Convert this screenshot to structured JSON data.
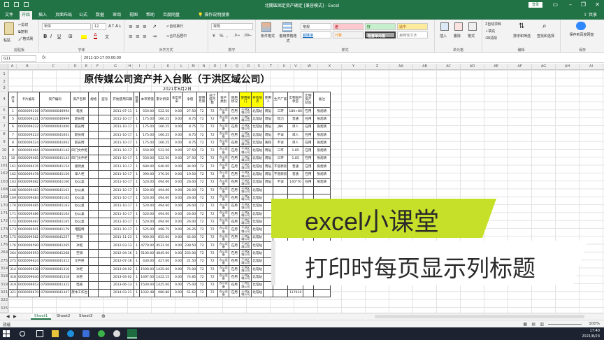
{
  "window": {
    "title": "北關區固定资产确定 [兼容模式] - Excel",
    "login_label": "登录"
  },
  "tabs": [
    "文件",
    "开始",
    "插入",
    "页面布局",
    "公式",
    "数据",
    "审阅",
    "视图",
    "帮助",
    "百度网盘",
    "操作说明搜索"
  ],
  "share_label": "共享",
  "ribbon": {
    "clipboard": {
      "group": "剪贴板",
      "paste": "粘贴",
      "cut": "剪切",
      "copy": "复制",
      "format_painter": "格式刷"
    },
    "font": {
      "group": "字体",
      "font_name": "宋体",
      "font_size": "12",
      "bold": "B",
      "italic": "I",
      "underline": "U",
      "font_color_icon": "A"
    },
    "alignment": {
      "group": "对齐方式",
      "wrap": "自动换行",
      "merge": "合并后居中"
    },
    "number": {
      "group": "数字",
      "format": "常规"
    },
    "styles": {
      "group": "样式",
      "conditional": "条件格式",
      "table_format": "套用表格格式",
      "cells": [
        {
          "label": "常规",
          "bg": "#ffffff",
          "fg": "#222222"
        },
        {
          "label": "差",
          "bg": "#ffc7ce",
          "fg": "#9c0006"
        },
        {
          "label": "好",
          "bg": "#c6efce",
          "fg": "#006100"
        },
        {
          "label": "适中",
          "bg": "#ffeb9c",
          "fg": "#9c5700"
        },
        {
          "label": "超链接",
          "bg": "#ffffff",
          "fg": "#0563c1"
        },
        {
          "label": "计算",
          "bg": "#f2f2f2",
          "fg": "#fa7d00"
        },
        {
          "label": "检查单元格",
          "bg": "#a5a5a5",
          "fg": "#ffffff"
        },
        {
          "label": "解释性文本",
          "bg": "#ffffff",
          "fg": "#7f7f7f"
        }
      ]
    },
    "cells_group": {
      "group": "单元格",
      "insert": "插入",
      "delete": "删除",
      "format": "格式"
    },
    "editing": {
      "group": "编辑",
      "autosum": "自动求和",
      "fill": "填充",
      "clear": "清除",
      "sort": "排序和筛选",
      "find": "查找和选择"
    },
    "save": {
      "group": "保存",
      "label": "保存到百度网盘"
    }
  },
  "formula_bar": {
    "name_box": "G11",
    "fx": "fx",
    "value": "2011-10-17 00:00:00"
  },
  "columns": [
    "A",
    "B",
    "C",
    "D",
    "E",
    "F",
    "G",
    "H",
    "I",
    "J",
    "K",
    "L",
    "M",
    "N",
    "O",
    "P",
    "Q",
    "R",
    "S",
    "T",
    "U",
    "V",
    "W",
    "X",
    "Y",
    "Z",
    "AA",
    "AB",
    "AC",
    "AD",
    "AE",
    "AF",
    "AG",
    "AH",
    "AI"
  ],
  "row_numbers": [
    "1",
    "2",
    "3",
    "4",
    "5",
    "6",
    "7",
    "8",
    "9",
    "10",
    "11",
    "161",
    "162",
    "163",
    "168",
    "169",
    "170",
    "171",
    "172",
    "173",
    "175",
    "176",
    "264",
    "275",
    "314",
    "318",
    "319",
    "321",
    "322",
    "325"
  ],
  "report": {
    "title": "原传媒公司资产并入台账（于洪区域公司）",
    "date": "2021年6月2日",
    "headers": [
      "序号",
      "卡片编号",
      "资产编码",
      "资产名称",
      "规格",
      "型号",
      "开始使用日期",
      "数量",
      "本币原值",
      "累计折旧",
      "本年折旧",
      "净值",
      "使用月限",
      "已计提月数",
      "资产类别",
      "使用状况",
      "使用部门",
      "存放地点",
      "使用人",
      "生产厂家",
      "实物资产状态",
      "实物资产状态",
      "备注"
    ],
    "highlight_headers": [
      16,
      17
    ],
    "rows": [
      [
        "1",
        "0000009216",
        "07000000040994",
        "电视",
        "",
        "",
        "2011-07-11",
        "1",
        "550.00",
        "522.50",
        "0.00",
        "27.50",
        "72",
        "72",
        "办公设备",
        "在用",
        "于洪区域公司",
        "北馆站",
        "周韬",
        "三环",
        "180+80",
        "在用",
        "张旭清"
      ],
      [
        "5",
        "0000009221",
        "07000000040999",
        "职员椅",
        "",
        "",
        "2011-10-17",
        "1",
        "175.00",
        "166.25",
        "0.00",
        "8.75",
        "72",
        "72",
        "办公设备",
        "在用",
        "于洪区域公司",
        "北馆站",
        "周韬",
        "得力",
        "普通",
        "在用",
        "张旭清"
      ],
      [
        "6",
        "0000009222",
        "07000000041000",
        "职员椅",
        "",
        "",
        "2011-10-17",
        "1",
        "175.00",
        "166.25",
        "0.00",
        "8.75",
        "72",
        "72",
        "办公设备",
        "在用",
        "于洪区域公司",
        "北馆站",
        "周韬",
        "JN6",
        "单人",
        "在用",
        "张旭清"
      ],
      [
        "7",
        "0000009223",
        "07000000041001",
        "职员椅",
        "",
        "",
        "2011-10-17",
        "1",
        "175.00",
        "166.25",
        "0.00",
        "8.75",
        "72",
        "72",
        "办公设备",
        "在用",
        "于洪区域公司",
        "北馆站",
        "周韬",
        "不详",
        "单人",
        "在用",
        "张旭清"
      ],
      [
        "8",
        "0000009224",
        "07000000041002",
        "职员椅",
        "",
        "",
        "2011-10-17",
        "1",
        "175.00",
        "166.25",
        "0.00",
        "8.75",
        "72",
        "72",
        "办公设备",
        "在用",
        "于洪区域公司",
        "北馆站",
        "黄辉",
        "不详",
        "单人",
        "在用",
        "张旭清"
      ],
      [
        "9",
        "0000009464",
        "07000000041142",
        "四门文件柜",
        "",
        "",
        "2011-10-17",
        "1",
        "550.00",
        "522.50",
        "0.00",
        "27.50",
        "72",
        "72",
        "办公设备",
        "在用",
        "于洪区域公司",
        "北馆站",
        "周韬",
        "三环",
        "1.85",
        "在用",
        "张旭清"
      ],
      [
        "10",
        "0000009465",
        "07000000041143",
        "四门文件柜",
        "",
        "",
        "2011-10-17",
        "1",
        "550.00",
        "522.50",
        "0.00",
        "27.50",
        "72",
        "72",
        "办公设备",
        "在用",
        "于洪区域公司",
        "北馆站",
        "周韬",
        "三环",
        "1.85",
        "在用",
        "张旭清"
      ],
      [
        "161",
        "0000009476",
        "07000000041154",
        "接待桌",
        "",
        "",
        "2011-10-17",
        "1",
        "680.00",
        "646.00",
        "0.00",
        "34.00",
        "72",
        "72",
        "办公设备",
        "在用",
        "于洪区域公司",
        "北馆站",
        "周韬",
        "不道新房",
        "普通",
        "在用",
        "张旭清"
      ],
      [
        "162",
        "0000009478",
        "07000000041156",
        "单人柜",
        "",
        "",
        "2011-10-17",
        "1",
        "390.00",
        "370.50",
        "0.00",
        "19.50",
        "72",
        "72",
        "办公设备",
        "在用",
        "于洪区域公司",
        "北馆站",
        "周韬",
        "不道新房",
        "普通",
        "在用",
        "张旭清"
      ],
      [
        "163",
        "0000009482",
        "07000000041160",
        "办公桌",
        "",
        "",
        "2011-10-17",
        "1",
        "520.00",
        "494.00",
        "0.00",
        "26.00",
        "72",
        "72",
        "办公设备",
        "在用",
        "于洪区域公司",
        "北馆站",
        "周韬",
        "不详",
        "140*70",
        "在用",
        "张旭清"
      ],
      [
        "168",
        "0000009483",
        "07000000041161",
        "办公桌",
        "",
        "",
        "2011-10-17",
        "1",
        "520.00",
        "494.00",
        "0.00",
        "26.00",
        "72",
        "72",
        "办公设备",
        "在用",
        "于洪区域公司",
        "北馆站",
        "",
        "",
        "",
        "",
        ""
      ],
      [
        "169",
        "0000009484",
        "07000000041162",
        "办公桌",
        "",
        "",
        "2011-10-17",
        "1",
        "520.00",
        "494.00",
        "0.00",
        "26.00",
        "72",
        "72",
        "办公设备",
        "在用",
        "于洪区域公司",
        "北馆站",
        "",
        "",
        "",
        "",
        ""
      ],
      [
        "170",
        "0000009485",
        "07000000041163",
        "办公桌",
        "",
        "",
        "2011-10-17",
        "1",
        "520.00",
        "494.00",
        "0.00",
        "26.00",
        "72",
        "72",
        "办公设备",
        "在用",
        "于洪区域公司",
        "北馆站",
        "",
        "",
        "",
        "",
        ""
      ],
      [
        "171",
        "0000009486",
        "07000000041164",
        "办公桌",
        "",
        "",
        "2011-10-17",
        "1",
        "520.00",
        "494.00",
        "0.00",
        "26.00",
        "72",
        "72",
        "办公设备",
        "在用",
        "于洪区域公司",
        "北馆站",
        "",
        "",
        "",
        "",
        ""
      ],
      [
        "172",
        "0000009487",
        "07000000041165",
        "办公桌",
        "",
        "",
        "2011-10-17",
        "1",
        "520.00",
        "494.00",
        "0.00",
        "26.00",
        "72",
        "72",
        "办公设备",
        "在用",
        "于洪区域公司",
        "北馆站",
        "",
        "",
        "",
        "",
        ""
      ],
      [
        "173",
        "0000009501",
        "07000000041179",
        "电脑椅",
        "",
        "",
        "2011-10-17",
        "1",
        "525.00",
        "498.75",
        "0.00",
        "26.25",
        "72",
        "72",
        "办公设备",
        "在用",
        "于洪区域公司",
        "北馆站",
        "",
        "",
        "",
        "",
        ""
      ],
      [
        "175",
        "0000009582",
        "07000000041257",
        "空调",
        "",
        "",
        "2011-11-23",
        "1",
        "900.00",
        "855.00",
        "0.00",
        "45.00",
        "72",
        "72",
        "办公设备",
        "在用",
        "于洪区域公司",
        "北馆站",
        "",
        "",
        "",
        "",
        ""
      ],
      [
        "176",
        "0000009590",
        "07000000041265",
        "冰柜",
        "",
        "",
        "2012-03-13",
        "1",
        "4770.00",
        "4531.50",
        "0.00",
        "238.50",
        "72",
        "72",
        "办公设备",
        "在用",
        "于洪区域公司",
        "北馆站",
        "",
        "",
        "",
        "",
        ""
      ],
      [
        "264",
        "0000009593",
        "07000000041268",
        "空调",
        "",
        "",
        "2012-04-16",
        "1",
        "5100.00",
        "4845.00",
        "0.00",
        "255.00",
        "72",
        "72",
        "办公设备",
        "在用",
        "于洪区域公司",
        "北馆站",
        "",
        "",
        "",
        "",
        ""
      ],
      [
        "275",
        "0000009624",
        "07000000041312",
        "文件柜",
        "",
        "",
        "2012-07-16",
        "1",
        "430.00",
        "427.00",
        "0.00",
        "21.50",
        "72",
        "72",
        "办公设备",
        "在用",
        "于洪区域公司",
        "北馆站",
        "",
        "",
        "",
        "",
        ""
      ],
      [
        "314",
        "0000009638",
        "07000000041316",
        "冰柜",
        "",
        "",
        "2013-04-02",
        "1",
        "1500.00",
        "1425.00",
        "0.00",
        "75.00",
        "72",
        "72",
        "办公设备",
        "在用",
        "于洪区域公司",
        "北馆站",
        "",
        "",
        "",
        "",
        ""
      ],
      [
        "318",
        "0000009640",
        "07000000041318",
        "冰柜",
        "",
        "",
        "2013-04-02",
        "1",
        "1497.00",
        "1422.15",
        "0.00",
        "74.85",
        "72",
        "72",
        "办公设备",
        "在用",
        "于洪区域公司",
        "北馆站",
        "",
        "",
        "",
        "",
        ""
      ],
      [
        "319",
        "0000009653",
        "07000000041322",
        "电视",
        "",
        "",
        "2013-06-13",
        "1",
        "1500.00",
        "1425.00",
        "0.00",
        "75.00",
        "72",
        "72",
        "办公设备",
        "在用",
        "于洪区域公司",
        "北馆站",
        "",
        "",
        "",
        "",
        ""
      ],
      [
        "321",
        "0000009670",
        "07000000041347",
        "原木工作台",
        "",
        "",
        "2014-03-21",
        "1",
        "1032.48",
        "980.86",
        "0.00",
        "51.62",
        "72",
        "72",
        "办公设备",
        "在用",
        "于洪区域公司",
        "北馆站",
        "",
        "",
        "117610",
        "",
        ""
      ]
    ]
  },
  "overlay": {
    "line1": "excel小课堂",
    "line2": "打印时每页显示列标题"
  },
  "sheet_tabs": [
    "Sheet1",
    "Sheet2",
    "Sheet3"
  ],
  "status": {
    "ready": "就绪",
    "zoom": "100%"
  },
  "taskbar": {
    "time": "17:40",
    "date": "2021/8/23"
  }
}
